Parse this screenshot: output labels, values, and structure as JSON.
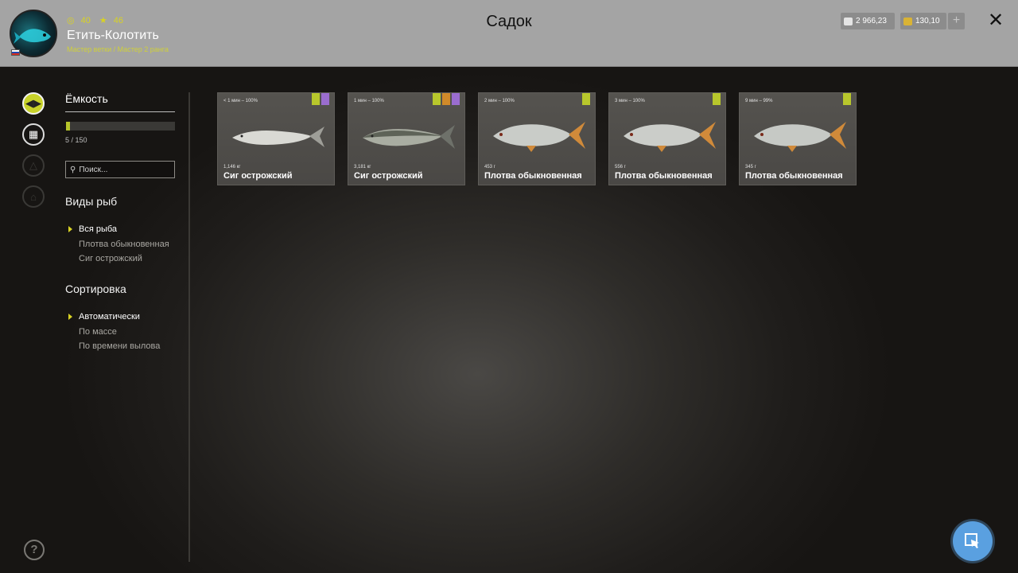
{
  "header": {
    "title": "Садок",
    "player": {
      "level": "40",
      "stars": "46",
      "name": "Етить-Колотить",
      "rank": "Мастер ветки / Мастер 2 ранга"
    },
    "currency": {
      "silver": "2 966,23",
      "gold": "130,10"
    },
    "plus_label": "+",
    "close_label": "✕"
  },
  "sidebar": {
    "capacity_title": "Ёмкость",
    "capacity_text": "5 / 150",
    "capacity_fraction": 0.033,
    "search_placeholder": "Поиск...",
    "species_title": "Виды рыб",
    "species": [
      "Вся рыба",
      "Плотва обыкновенная",
      "Сиг острожский"
    ],
    "sort_title": "Сортировка",
    "sort": [
      "Автоматически",
      "По массе",
      "По времени вылова"
    ]
  },
  "fish": [
    {
      "meta": "< 1 мин – 100%",
      "weight": "1,146 кг",
      "name": "Сиг острожский",
      "badges": [
        "green",
        "purple"
      ],
      "type": "sig"
    },
    {
      "meta": "1 мин – 100%",
      "weight": "3,181 кг",
      "name": "Сиг острожский",
      "badges": [
        "green",
        "orange",
        "purple"
      ],
      "type": "sig"
    },
    {
      "meta": "2 мин – 100%",
      "weight": "453 г",
      "name": "Плотва обыкновенная",
      "badges": [
        "green"
      ],
      "type": "roach"
    },
    {
      "meta": "3 мин – 100%",
      "weight": "556 г",
      "name": "Плотва обыкновенная",
      "badges": [
        "green"
      ],
      "type": "roach"
    },
    {
      "meta": "9 мин – 99%",
      "weight": "345 г",
      "name": "Плотва обыкновенная",
      "badges": [
        "green"
      ],
      "type": "roach"
    }
  ],
  "colors": {
    "accent": "#c8d22a",
    "header_bg": "#a4a4a4",
    "fab": "#5aa0e0"
  }
}
